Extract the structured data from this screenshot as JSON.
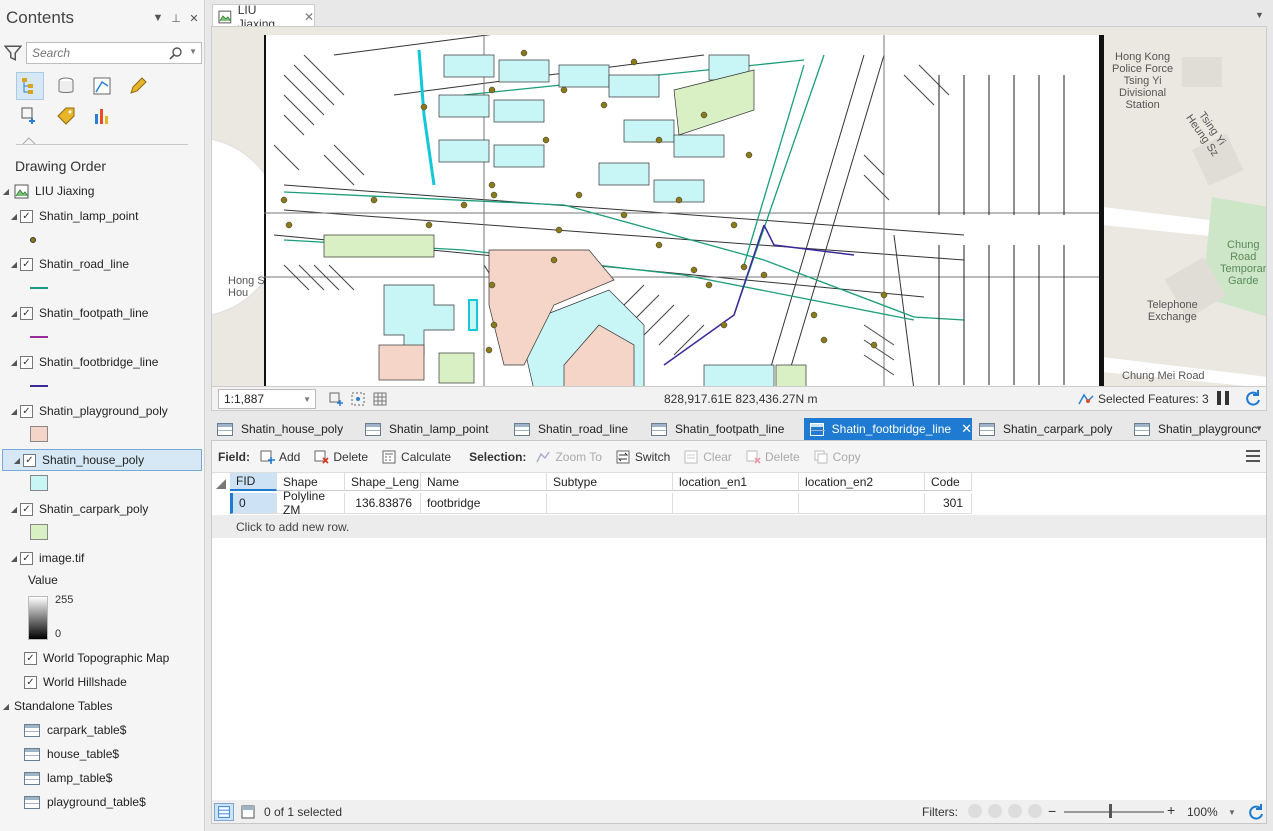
{
  "contents": {
    "title": "Contents",
    "search_placeholder": "Search",
    "drawing_order_label": "Drawing Order",
    "map_name": "LIU Jiaxing",
    "layers": [
      {
        "name": "Shatin_lamp_point",
        "checked": true,
        "swatch": "#8b7a1a"
      },
      {
        "name": "Shatin_road_line",
        "checked": true,
        "swatch": "#1a9e7a"
      },
      {
        "name": "Shatin_footpath_line",
        "checked": true,
        "swatch": "#9b2d9b"
      },
      {
        "name": "Shatin_footbridge_line",
        "checked": true,
        "swatch": "#3c2a9a"
      },
      {
        "name": "Shatin_playground_poly",
        "checked": true,
        "swatch": "#f5d5c8"
      },
      {
        "name": "Shatin_house_poly",
        "checked": true,
        "swatch": "#c8f5f5"
      },
      {
        "name": "Shatin_carpark_poly",
        "checked": true,
        "swatch": "#d8f0c4"
      },
      {
        "name": "image.tif",
        "checked": true
      }
    ],
    "raster_value_label": "Value",
    "raster_high": "255",
    "raster_low": "0",
    "basemaps": [
      {
        "name": "World Topographic Map",
        "checked": true
      },
      {
        "name": "World Hillshade",
        "checked": true
      }
    ],
    "standalone_label": "Standalone Tables",
    "tables": [
      "carpark_table$",
      "house_table$",
      "lamp_table$",
      "playground_table$"
    ]
  },
  "map": {
    "tab_title": "LIU Jiaxing",
    "labels": {
      "police": "Hong Kong\nPolice Force\nTsing Yi\nDivisional\nStation",
      "street": "Tsing Yi Heung Sz",
      "telephone": "Telephone\nExchange",
      "chung": "Chung\nRoad\nTemporar\nGarde",
      "chung_mei_road": "Chung Mei Road",
      "hong": "Hong S\nHou"
    },
    "scale": "1:1,887",
    "coordinates": "828,917.61E 823,436.27N m",
    "selected_features": "Selected Features: 3"
  },
  "attribute_tabs": [
    {
      "label": "Shatin_house_poly",
      "active": false
    },
    {
      "label": "Shatin_lamp_point",
      "active": false
    },
    {
      "label": "Shatin_road_line",
      "active": false
    },
    {
      "label": "Shatin_footpath_line",
      "active": false
    },
    {
      "label": "Shatin_footbridge_line",
      "active": true
    },
    {
      "label": "Shatin_carpark_poly",
      "active": false
    },
    {
      "label": "Shatin_playgrounc",
      "active": false
    }
  ],
  "toolbar": {
    "field_label": "Field:",
    "add": "Add",
    "delete": "Delete",
    "calculate": "Calculate",
    "selection_label": "Selection:",
    "zoom_to": "Zoom To",
    "switch": "Switch",
    "clear": "Clear",
    "sel_delete": "Delete",
    "copy": "Copy"
  },
  "table": {
    "columns": [
      "FID",
      "Shape",
      "Shape_Leng",
      "Name",
      "Subtype",
      "location_en1",
      "location_en2",
      "Code"
    ],
    "rows": [
      [
        "0",
        "Polyline ZM",
        "136.83876",
        "footbridge",
        "",
        "",
        "",
        "301"
      ]
    ],
    "add_row_hint": "Click to add new row."
  },
  "bottom": {
    "selection_count": "0 of 1 selected",
    "filters_label": "Filters:",
    "zoom": "100%"
  },
  "colors": {
    "accent": "#1e7bd1",
    "selected_bg": "#d6e8f5",
    "lamp": "#8b7a1a",
    "road": "#1a9e7a",
    "footpath": "#9b2d9b",
    "footbridge": "#3c2a9a",
    "playground": "#f5d5c8",
    "house": "#c8f5f5",
    "carpark": "#d8f0c4"
  }
}
